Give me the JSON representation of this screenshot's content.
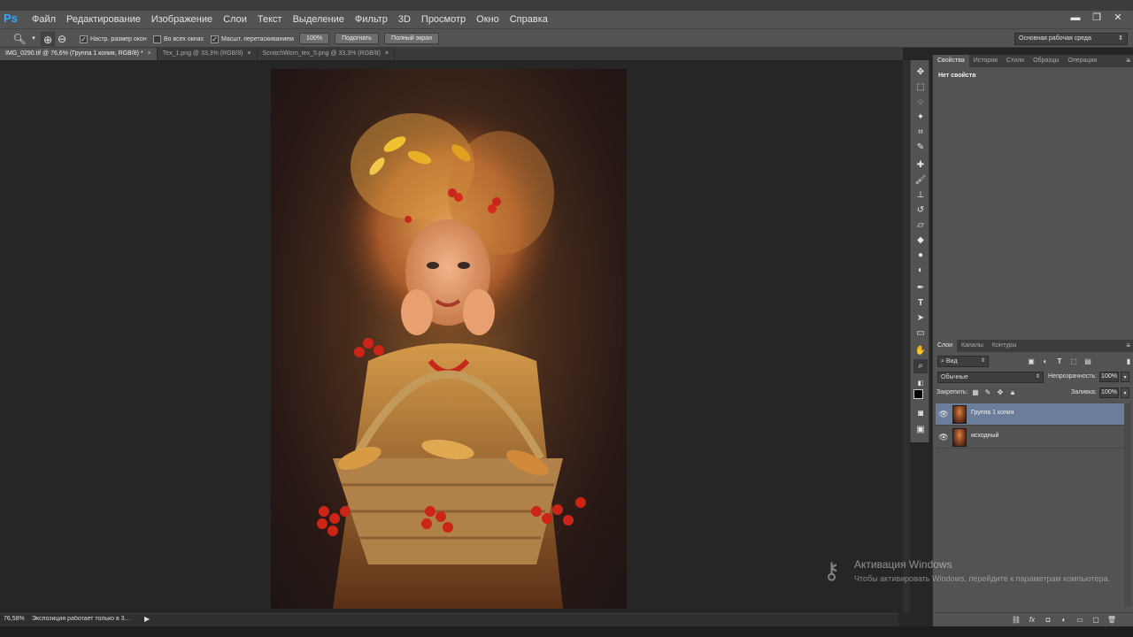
{
  "app": {
    "logo": "Ps"
  },
  "menu": [
    "Файл",
    "Редактирование",
    "Изображение",
    "Слои",
    "Текст",
    "Выделение",
    "Фильтр",
    "3D",
    "Просмотр",
    "Окно",
    "Справка"
  ],
  "window_controls": {
    "minimize": "▬",
    "restore": "❐",
    "close": "✕"
  },
  "options": {
    "tool_icon": "zoom-icon",
    "check1": "Настр. размер окон",
    "check2": "Во всех окнах",
    "check3": "Масшт. перетаскиванием",
    "btn_100": "100%",
    "btn_fit": "Подогнать",
    "btn_full": "Полный экран",
    "workspace": "Основная рабочая среда"
  },
  "tabs": [
    {
      "label": "IMG_0290.tif @ 76,6% (Группа 1 копия, RGB/8) *",
      "close": "×"
    },
    {
      "label": "Tex_1.png @ 33,3% (RGB/8)",
      "close": "×"
    },
    {
      "label": "ScratchWorn_tex_5.png @ 33,3% (RGB/8)",
      "close": "×"
    }
  ],
  "status": {
    "zoom": "76,58%",
    "info": "Экспозиция работает только в 3...",
    "arrow": "▶"
  },
  "properties_panel": {
    "tabs": [
      "Свойства",
      "История",
      "Стили",
      "Образцы",
      "Операции"
    ],
    "title": "Нет свойств"
  },
  "layers_panel": {
    "tabs": [
      "Слои",
      "Каналы",
      "Контуры"
    ],
    "kind": "Вид",
    "blend_mode": "Обычные",
    "opacity_label": "Непрозрачность:",
    "opacity_value": "100%",
    "lock_label": "Закрепить:",
    "fill_label": "Заливка:",
    "fill_value": "100%",
    "layers": [
      {
        "name": "Группа 1 копия",
        "selected": true
      },
      {
        "name": "исходный",
        "selected": false
      }
    ]
  },
  "watermark": {
    "title": "Активация Windows",
    "subtitle": "Чтобы активировать Windows, перейдите к параметрам компьютера."
  }
}
